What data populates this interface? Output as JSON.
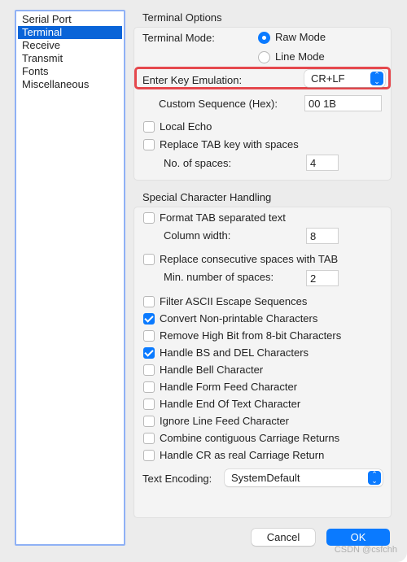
{
  "sidebar": {
    "items": [
      {
        "label": "Serial Port",
        "selected": false
      },
      {
        "label": "Terminal",
        "selected": true
      },
      {
        "label": "Receive",
        "selected": false
      },
      {
        "label": "Transmit",
        "selected": false
      },
      {
        "label": "Fonts",
        "selected": false
      },
      {
        "label": "Miscellaneous",
        "selected": false
      }
    ]
  },
  "terminal_options": {
    "title": "Terminal Options",
    "terminal_mode_label": "Terminal Mode:",
    "raw_mode": "Raw Mode",
    "line_mode": "Line Mode",
    "selected_mode": "Raw Mode",
    "enter_key_label": "Enter Key Emulation:",
    "enter_key_value": "CR+LF",
    "custom_seq_label": "Custom Sequence (Hex):",
    "custom_seq_value": "00 1B",
    "local_echo": {
      "label": "Local Echo",
      "checked": false
    },
    "replace_tab": {
      "label": "Replace TAB key with spaces",
      "checked": false
    },
    "num_spaces_label": "No. of spaces:",
    "num_spaces_value": "4"
  },
  "special": {
    "title": "Special Character Handling",
    "format_tab": {
      "label": "Format TAB separated text",
      "checked": false
    },
    "column_width_label": "Column width:",
    "column_width_value": "8",
    "replace_spaces": {
      "label": "Replace consecutive spaces with TAB",
      "checked": false
    },
    "min_spaces_label": "Min. number of spaces:",
    "min_spaces_value": "2",
    "options": [
      {
        "label": "Filter ASCII Escape Sequences",
        "checked": false
      },
      {
        "label": "Convert Non-printable Characters",
        "checked": true
      },
      {
        "label": "Remove High Bit from 8-bit Characters",
        "checked": false
      },
      {
        "label": "Handle BS and DEL Characters",
        "checked": true
      },
      {
        "label": "Handle Bell Character",
        "checked": false
      },
      {
        "label": "Handle Form Feed Character",
        "checked": false
      },
      {
        "label": "Handle End Of Text Character",
        "checked": false
      },
      {
        "label": "Ignore Line Feed Character",
        "checked": false
      },
      {
        "label": "Combine contiguous Carriage Returns",
        "checked": false
      },
      {
        "label": "Handle CR as real Carriage Return",
        "checked": false
      }
    ],
    "encoding_label": "Text Encoding:",
    "encoding_value": "SystemDefault"
  },
  "buttons": {
    "cancel": "Cancel",
    "ok": "OK"
  },
  "watermark": "CSDN @csfchh",
  "colors": {
    "accent": "#0a7aff",
    "selection": "#0a64d8",
    "highlight": "#e5484d"
  }
}
